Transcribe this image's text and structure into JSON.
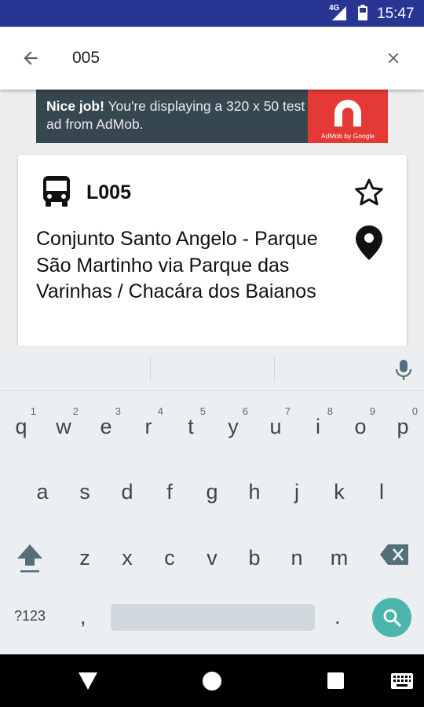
{
  "status_bar": {
    "network": "4G",
    "time": "15:47"
  },
  "search": {
    "query": "005"
  },
  "ad": {
    "headline": "Nice job!",
    "body": " You're displaying a 320 x 50 test ad from AdMob.",
    "caption": "AdMob by Google"
  },
  "result": {
    "code": "L005",
    "route": "Conjunto Santo Angelo - Parque São Martinho via Parque das Varinhas / Chacára dos Baianos"
  },
  "keyboard": {
    "row1": [
      {
        "c": "q",
        "h": "1"
      },
      {
        "c": "w",
        "h": "2"
      },
      {
        "c": "e",
        "h": "3"
      },
      {
        "c": "r",
        "h": "4"
      },
      {
        "c": "t",
        "h": "5"
      },
      {
        "c": "y",
        "h": "6"
      },
      {
        "c": "u",
        "h": "7"
      },
      {
        "c": "i",
        "h": "8"
      },
      {
        "c": "o",
        "h": "9"
      },
      {
        "c": "p",
        "h": "0"
      }
    ],
    "row2": [
      "a",
      "s",
      "d",
      "f",
      "g",
      "h",
      "j",
      "k",
      "l"
    ],
    "row3": [
      "z",
      "x",
      "c",
      "v",
      "b",
      "n",
      "m"
    ],
    "symbols_label": "?123",
    "comma": ",",
    "period": "."
  },
  "icons": {
    "back": "arrow-back-icon",
    "clear": "close-icon",
    "bus": "bus-icon",
    "favorite": "star-outline-icon",
    "location": "map-pin-icon",
    "mic": "mic-icon",
    "shift": "shift-icon",
    "backspace": "backspace-icon",
    "search": "search-icon"
  },
  "colors": {
    "status_bar": "#283593",
    "search_key": "#4db6ac",
    "ad_logo": "#e53935"
  }
}
